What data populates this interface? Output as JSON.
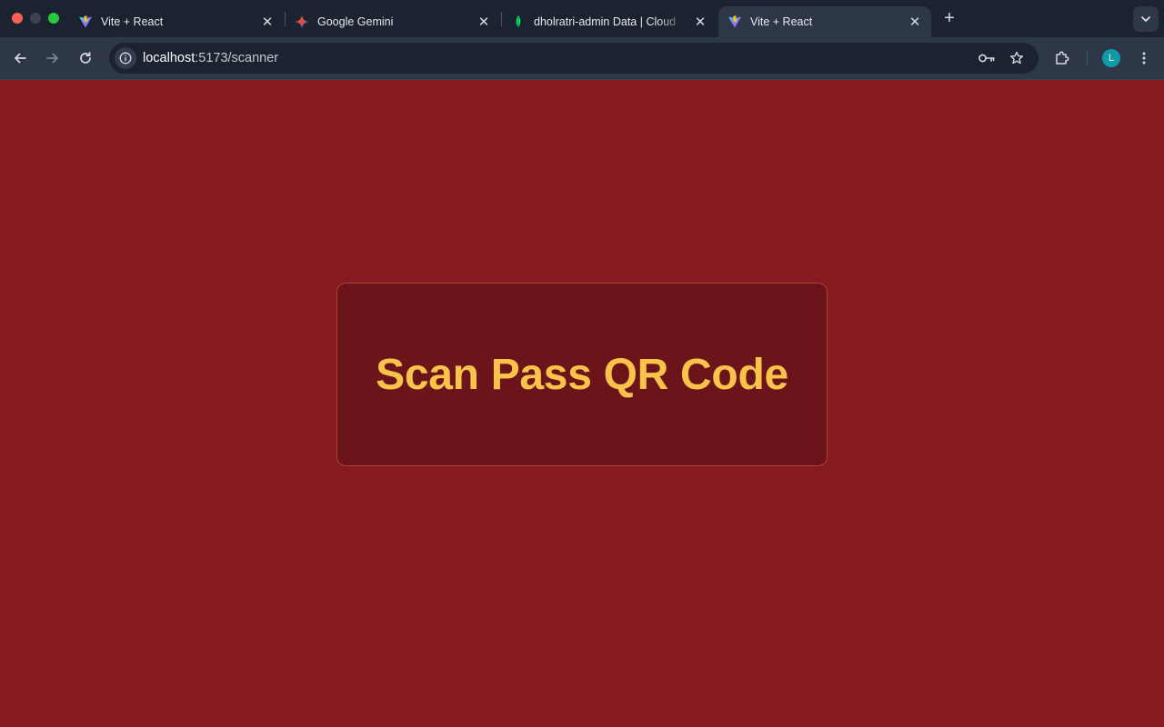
{
  "browser": {
    "tabs": [
      {
        "title": "Vite + React",
        "favicon": "vite-logo-icon",
        "active": false
      },
      {
        "title": "Google Gemini",
        "favicon": "gemini-sparkle-icon",
        "active": false
      },
      {
        "title": "dholratri-admin Data | Cloud",
        "favicon": "mongodb-leaf-icon",
        "active": false
      },
      {
        "title": "Vite + React",
        "favicon": "vite-logo-icon",
        "active": true
      }
    ],
    "address": {
      "host": "localhost",
      "path": ":5173/scanner"
    },
    "profile_initial": "L",
    "colors": {
      "tabbar_bg": "#1b2230",
      "toolbar_bg": "#2e3747",
      "avatar_bg": "#0f9aa8"
    }
  },
  "page": {
    "heading": "Scan Pass QR Code",
    "colors": {
      "background": "#851b20",
      "card_background": "#6b151a",
      "card_border": "#a8412e",
      "heading": "#fcc34a"
    }
  }
}
